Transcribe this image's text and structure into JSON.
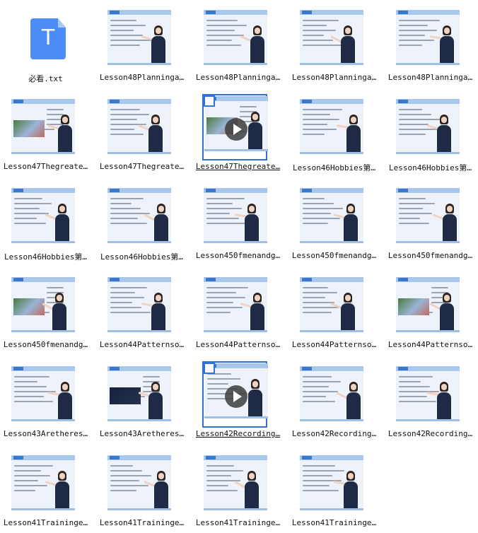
{
  "files": [
    {
      "label": "必看.txt",
      "kind": "txt",
      "icon_letter": "T",
      "icon": "text-file-icon",
      "icon_color": "#4c8df5"
    },
    {
      "label": "Lesson48Planninga…",
      "kind": "video"
    },
    {
      "label": "Lesson48Planninga…",
      "kind": "video"
    },
    {
      "label": "Lesson48Planninga…",
      "kind": "video"
    },
    {
      "label": "Lesson48Planninga…",
      "kind": "video"
    },
    {
      "label": "Lesson47Thegreate…",
      "kind": "video",
      "photo": "color"
    },
    {
      "label": "Lesson47Thegreate…",
      "kind": "video"
    },
    {
      "label": "Lesson47Thegreate…",
      "kind": "video",
      "selected": true,
      "play": true,
      "photo": "color"
    },
    {
      "label": "Lesson46Hobbies第…",
      "kind": "video"
    },
    {
      "label": "Lesson46Hobbies第…",
      "kind": "video"
    },
    {
      "label": "Lesson46Hobbies第…",
      "kind": "video"
    },
    {
      "label": "Lesson46Hobbies第…",
      "kind": "video"
    },
    {
      "label": "Lesson450fmenandg…",
      "kind": "video"
    },
    {
      "label": "Lesson450fmenandg…",
      "kind": "video"
    },
    {
      "label": "Lesson450fmenandg…",
      "kind": "video"
    },
    {
      "label": "Lesson450fmenandg…",
      "kind": "video",
      "photo": "color"
    },
    {
      "label": "Lesson44Patternso…",
      "kind": "video"
    },
    {
      "label": "Lesson44Patternso…",
      "kind": "video"
    },
    {
      "label": "Lesson44Patternso…",
      "kind": "video"
    },
    {
      "label": "Lesson44Patternso…",
      "kind": "video",
      "photo": "color"
    },
    {
      "label": "Lesson43Aretheres…",
      "kind": "video"
    },
    {
      "label": "Lesson43Aretheres…",
      "kind": "video",
      "photo": "dark"
    },
    {
      "label": "Lesson42Recording…",
      "kind": "video",
      "selected": true,
      "play": true
    },
    {
      "label": "Lesson42Recording…",
      "kind": "video"
    },
    {
      "label": "Lesson42Recording…",
      "kind": "video"
    },
    {
      "label": "Lesson41Traininge…",
      "kind": "video"
    },
    {
      "label": "Lesson41Traininge…",
      "kind": "video"
    },
    {
      "label": "Lesson41Traininge…",
      "kind": "video"
    },
    {
      "label": "Lesson41Traininge…",
      "kind": "video"
    }
  ]
}
